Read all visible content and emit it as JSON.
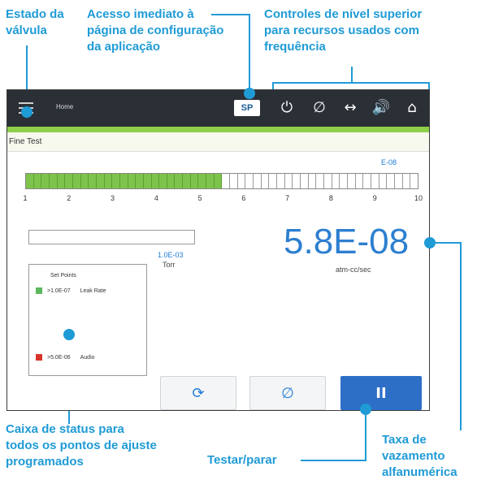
{
  "callouts": {
    "valve_state": [
      "Estado da",
      "válvula"
    ],
    "config_access": [
      "Acesso imediato à",
      "página de configuração",
      "da aplicação"
    ],
    "top_controls": [
      "Controles de nível superior",
      "para recursos usados com",
      "frequência"
    ],
    "status_box": [
      "Caixa de status para",
      "todos os pontos de ajuste",
      "programados"
    ],
    "test_stop": [
      "Testar/parar"
    ],
    "leak_rate": [
      "Taxa de",
      "vazamento",
      "alfanumérica"
    ]
  },
  "screen": {
    "topbar": {
      "menu_icon": "menu-icon",
      "home_label": "Home",
      "sp_label": "SP",
      "icons": [
        "power-icon",
        "zero-icon",
        "horizontal-arrow-icon",
        "speaker-icon",
        "home-icon"
      ]
    },
    "mode_label": "Fine Test",
    "bargraph": {
      "exponent_label": "E-08",
      "scale": [
        "1",
        "2",
        "3",
        "4",
        "5",
        "6",
        "7",
        "8",
        "9",
        "10"
      ],
      "total_segments": 50,
      "filled_fraction": 0.5
    },
    "small_value": "1.0E-03",
    "small_unit": "Torr",
    "leak_rate_value": "5.8E-08",
    "leak_rate_unit": "atm-cc/sec",
    "setpoints": {
      "title": "Set Points",
      "rows": [
        {
          "value": ">1.0E-07",
          "label": "Leak Rate",
          "color": "#5cb85c"
        },
        {
          "value": ">5.0E-06",
          "label": "Audio",
          "color": "#d9342b"
        }
      ]
    },
    "buttons": [
      {
        "name": "refresh-button",
        "icon": "refresh-icon"
      },
      {
        "name": "zero-button",
        "icon": "zero-icon"
      },
      {
        "name": "pause-button",
        "icon": "pause-icon"
      }
    ]
  },
  "colors": {
    "callout": "#1f9bd6",
    "topbar": "#2b2f36",
    "accent_green": "#8fcf4a",
    "primary_blue": "#2d6fc7"
  }
}
